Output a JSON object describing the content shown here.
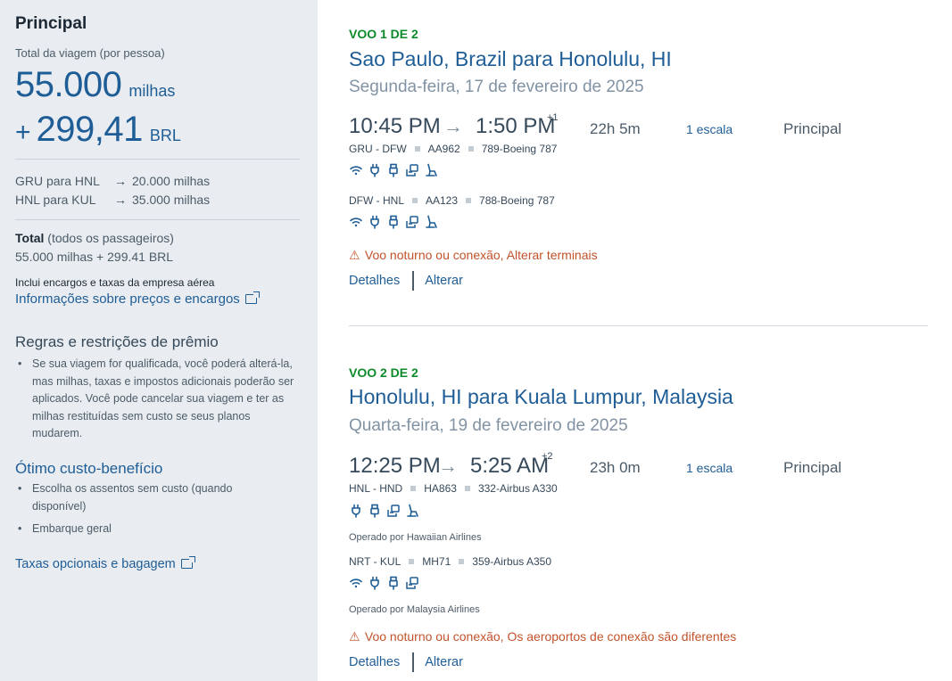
{
  "sidebar": {
    "title": "Principal",
    "subtitle": "Total da viagem (por pessoa)",
    "miles": "55.000",
    "miles_unit": "milhas",
    "plus": "+",
    "brl": "299,41",
    "brl_unit": "BRL",
    "legs": [
      {
        "route": "GRU para HNL",
        "miles": "20.000 milhas"
      },
      {
        "route": "HNL para KUL",
        "miles": "35.000 milhas"
      }
    ],
    "total_label": "Total",
    "total_paren": "(todos os passageiros)",
    "total_value": "55.000 milhas + 299.41 BRL",
    "note": "Inclui encargos e taxas da empresa aérea",
    "pricing_link": "Informações sobre preços e encargos",
    "rules_heading": "Regras e restrições de prêmio",
    "rules_bullets": [
      "Se sua viagem for qualificada, você poderá alterá-la, mas milhas, taxas e impostos adicionais poderão ser aplicados. Você pode cancelar sua viagem e ter as milhas restituídas sem custo se seus planos mudarem."
    ],
    "value_heading": "Ótimo custo-benefício",
    "value_bullets": [
      "Escolha os assentos sem custo (quando disponível)",
      "Embarque geral"
    ],
    "bags_link": "Taxas opcionais e bagagem"
  },
  "flights": [
    {
      "label": "VOO 1 DE 2",
      "route": "Sao Paulo, Brazil para Honolulu, HI",
      "date": "Segunda-feira, 17 de fevereiro de 2025",
      "depart": "10:45 PM",
      "arrive": "1:50 PM",
      "day_offset": "+1",
      "duration": "22h 5m",
      "stops": "1 escala",
      "cabin": "Principal",
      "segments": [
        {
          "route": "GRU - DFW",
          "flight": "AA962",
          "aircraft": "789-Boeing 787",
          "operated_by": "",
          "amenities": [
            "wifi-icon",
            "power-icon",
            "usb-icon",
            "entertainment-icon",
            "seat-icon"
          ]
        },
        {
          "route": "DFW - HNL",
          "flight": "AA123",
          "aircraft": "788-Boeing 787",
          "operated_by": "",
          "amenities": [
            "wifi-icon",
            "power-icon",
            "usb-icon",
            "entertainment-icon",
            "seat-icon"
          ]
        }
      ],
      "warning": "Voo noturno ou conexão, Alterar terminais",
      "details_label": "Detalhes",
      "change_label": "Alterar"
    },
    {
      "label": "VOO 2 DE 2",
      "route": "Honolulu, HI para Kuala Lumpur, Malaysia",
      "date": "Quarta-feira, 19 de fevereiro de 2025",
      "depart": "12:25 PM",
      "arrive": "5:25 AM",
      "day_offset": "+2",
      "duration": "23h 0m",
      "stops": "1 escala",
      "cabin": "Principal",
      "segments": [
        {
          "route": "HNL - HND",
          "flight": "HA863",
          "aircraft": "332-Airbus A330",
          "operated_by": "Operado por Hawaiian Airlines",
          "amenities": [
            "power-icon",
            "usb-icon",
            "entertainment-icon",
            "seat-icon"
          ]
        },
        {
          "route": "NRT - KUL",
          "flight": "MH71",
          "aircraft": "359-Airbus A350",
          "operated_by": "Operado por Malaysia Airlines",
          "amenities": [
            "wifi-icon",
            "power-icon",
            "usb-icon",
            "entertainment-icon"
          ]
        }
      ],
      "warning": "Voo noturno ou conexão, Os aeroportos de conexão são diferentes",
      "details_label": "Detalhes",
      "change_label": "Alterar"
    }
  ],
  "colors": {
    "link": "#1f5d96",
    "flight_label": "#0d8a2a",
    "warning": "#c2532b",
    "sidebar_bg": "#e9edf1"
  }
}
